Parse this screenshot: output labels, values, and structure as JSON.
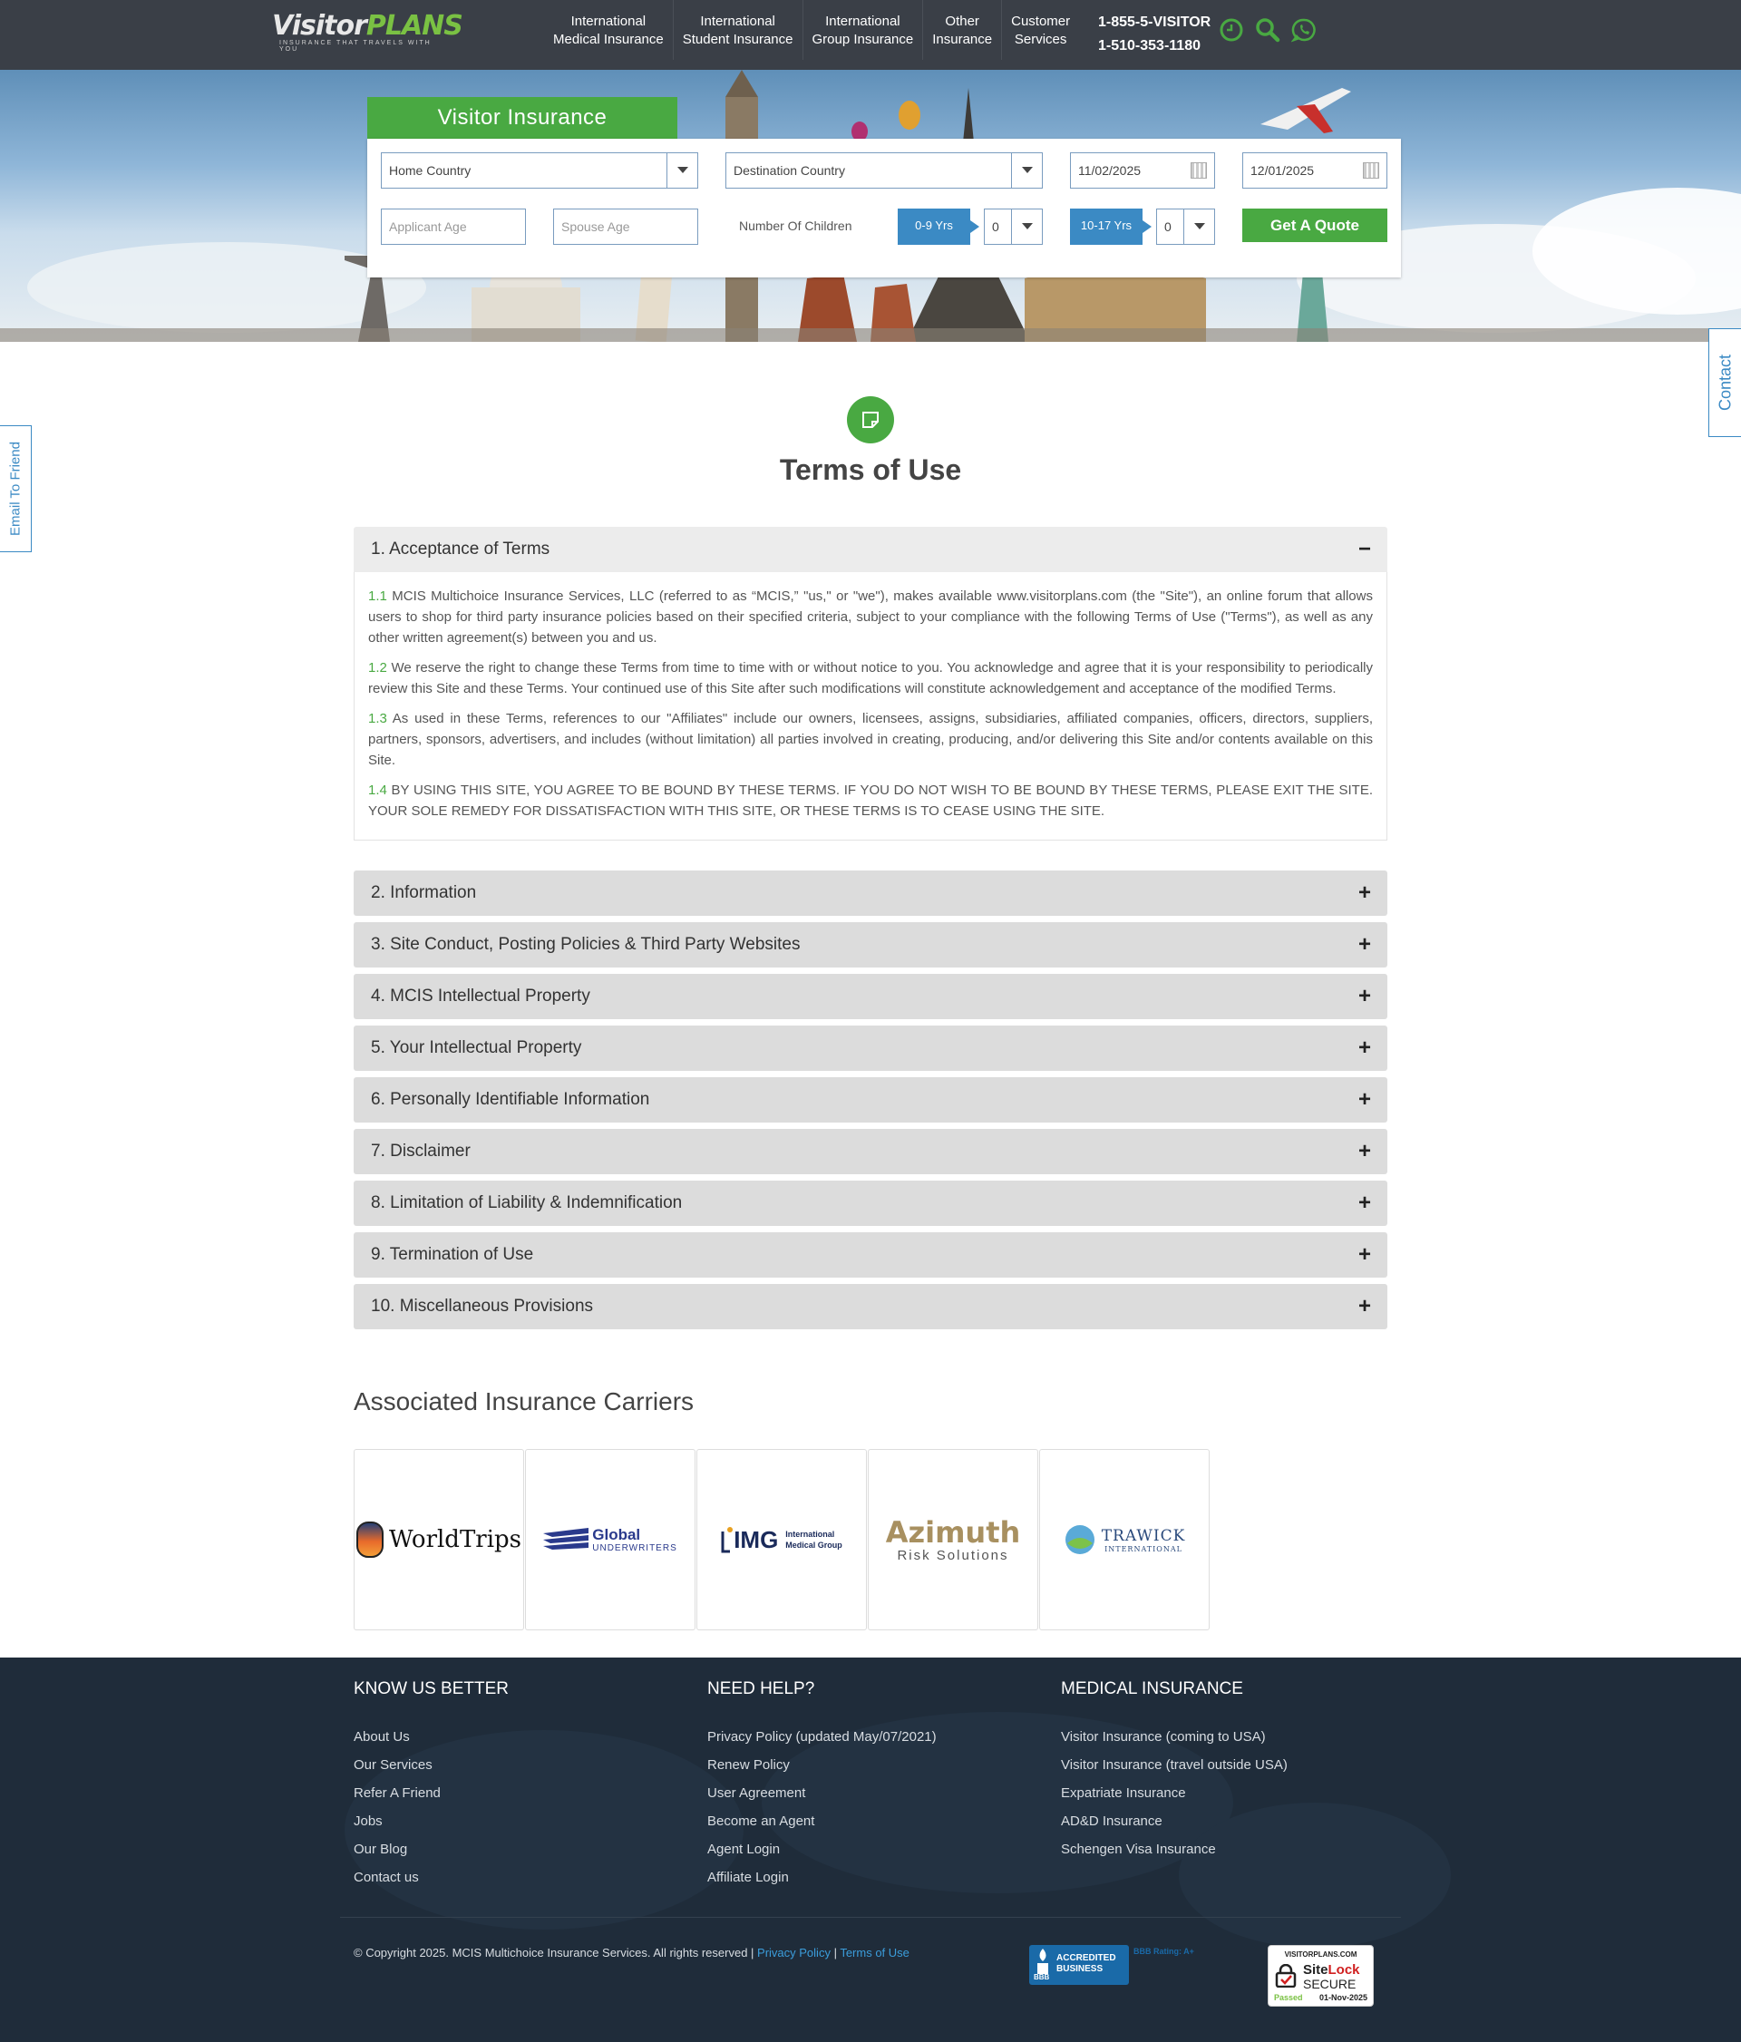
{
  "header": {
    "logo_visitor": "Visitor",
    "logo_plans": "PLANS",
    "logo_tagline": "INSURANCE THAT TRAVELS WITH YOU",
    "nav": [
      {
        "line1": "International",
        "line2": "Medical Insurance"
      },
      {
        "line1": "International",
        "line2": "Student Insurance"
      },
      {
        "line1": "International",
        "line2": "Group Insurance"
      },
      {
        "line1": "Other",
        "line2": "Insurance"
      },
      {
        "line1": "Customer",
        "line2": "Services"
      }
    ],
    "phone1": "1-855-5-VISITOR",
    "phone2": "1-510-353-1180",
    "icons": [
      "clock-icon",
      "search-icon",
      "whatsapp-icon"
    ],
    "accent_color": "#49a942"
  },
  "quote": {
    "tab_title": "Visitor Insurance",
    "home_country": "Home Country",
    "destination_country": "Destination Country",
    "start_date": "11/02/2025",
    "end_date": "12/01/2025",
    "applicant_age_placeholder": "Applicant Age",
    "spouse_age_placeholder": "Spouse  Age",
    "children_label": "Number Of Children",
    "age_group_1": "0-9 Yrs",
    "age_group_1_value": "0",
    "age_group_2": "10-17 Yrs",
    "age_group_2_value": "0",
    "button": "Get A Quote"
  },
  "side_tabs": {
    "email": "Email To Friend",
    "contact": "Contact"
  },
  "page": {
    "title": "Terms of Use"
  },
  "accordion": {
    "open_title": "1. Acceptance of Terms",
    "open_sign": "−",
    "closed_sign": "+",
    "paragraphs": [
      {
        "num": "1.1",
        "text": " MCIS Multichoice Insurance Services, LLC (referred to as “MCIS,” \"us,\" or \"we\"), makes available www.visitorplans.com (the \"Site\"), an online forum that allows users to shop for third party insurance policies based on their specified criteria, subject to your compliance with the following Terms of Use (\"Terms\"), as well as any other written agreement(s) between you and us."
      },
      {
        "num": "1.2",
        "text": " We reserve the right to change these Terms from time to time with or without notice to you. You acknowledge and agree that it is your responsibility to periodically review this Site and these Terms. Your continued use of this Site after such modifications will constitute acknowledgement and acceptance of the modified Terms."
      },
      {
        "num": "1.3",
        "text": " As used in these Terms, references to our \"Affiliates\" include our owners, licensees, assigns, subsidiaries, affiliated companies, officers, directors, suppliers, partners, sponsors, advertisers, and includes (without limitation) all parties involved in creating, producing, and/or delivering this Site and/or contents available on this Site."
      },
      {
        "num": "1.4",
        "text": " BY USING THIS SITE, YOU AGREE TO BE BOUND BY THESE TERMS. IF YOU DO NOT WISH TO BE BOUND BY THESE TERMS, PLEASE EXIT THE SITE. YOUR SOLE REMEDY FOR DISSATISFACTION WITH THIS SITE, OR THESE TERMS IS TO CEASE USING THE SITE."
      }
    ],
    "sections": [
      "2. Information",
      "3. Site Conduct, Posting Policies & Third Party Websites",
      "4. MCIS Intellectual Property",
      "5. Your Intellectual Property",
      "6. Personally Identifiable Information",
      "7. Disclaimer",
      "8. Limitation of Liability & Indemnification",
      "9. Termination of Use",
      "10. Miscellaneous Provisions"
    ]
  },
  "carriers": {
    "title": "Associated Insurance Carriers",
    "worldtrips": "WorldTrips",
    "global": "Global",
    "global_sub": "UNDERWRITERS",
    "img": "IMG",
    "img_sub1": "International",
    "img_sub2": "Medical Group",
    "azimuth": "Azimuth",
    "azimuth_sub": "Risk Solutions",
    "trawick": "TRAWICK",
    "trawick_sub": "INTERNATIONAL"
  },
  "footer": {
    "col1_title": "KNOW US BETTER",
    "col1_links": [
      "About Us",
      "Our Services",
      "Refer A Friend",
      "Jobs",
      "Our Blog",
      "Contact us"
    ],
    "col2_title": "NEED HELP?",
    "col2_links": [
      "Privacy Policy (updated May/07/2021)",
      "Renew Policy",
      "User Agreement",
      "Become an Agent",
      "Agent Login",
      "Affiliate Login"
    ],
    "col3_title": "MEDICAL INSURANCE",
    "col3_links": [
      "Visitor Insurance (coming to USA)",
      "Visitor Insurance (travel outside USA)",
      "Expatriate Insurance",
      "AD&D Insurance",
      "Schengen Visa Insurance"
    ],
    "copyright": "© Copyright 2025. MCIS Multichoice Insurance Services. All rights reserved | ",
    "privacy_link": "Privacy Policy",
    "separator": " | ",
    "terms_link": "Terms of Use",
    "bbb_line1": "ACCREDITED",
    "bbb_line2": "BUSINESS",
    "bbb_rating": "BBB Rating: A+",
    "bbb_mark": "BBB",
    "sitelock_site": "VISITORPLANS.COM",
    "sitelock_name1": "Site",
    "sitelock_name2": "Lock",
    "sitelock_secure": "SECURE",
    "sitelock_passed": "Passed",
    "sitelock_date": "01-Nov-2025"
  }
}
